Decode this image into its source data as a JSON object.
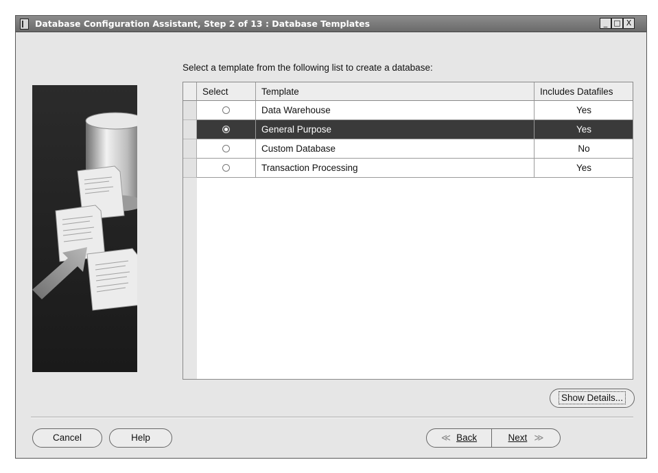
{
  "window": {
    "title": "Database Configuration Assistant, Step 2 of 13 : Database Templates",
    "controls": {
      "minimize": "_",
      "maximize": "□",
      "close": "X"
    }
  },
  "prompt": "Select a template from the following list to create a database:",
  "table": {
    "columns": [
      "Select",
      "Template",
      "Includes Datafiles"
    ],
    "rows": [
      {
        "selected": false,
        "template": "Data Warehouse",
        "includes_datafiles": "Yes"
      },
      {
        "selected": true,
        "template": "General Purpose",
        "includes_datafiles": "Yes"
      },
      {
        "selected": false,
        "template": "Custom Database",
        "includes_datafiles": "No"
      },
      {
        "selected": false,
        "template": "Transaction Processing",
        "includes_datafiles": "Yes"
      }
    ]
  },
  "buttons": {
    "show_details": "Show Details...",
    "cancel": "Cancel",
    "help": "Help",
    "back_arrow": "≪",
    "back": "Back",
    "next": "Next",
    "next_arrow": "≫"
  },
  "icons": {
    "side_illustration": "database-cylinder-with-documents-and-arrow",
    "app_icon": "database-assistant-icon"
  },
  "colors": {
    "selected_row": "#3a3a3a",
    "title_bar": "#7a7a7a",
    "window_bg": "#e6e6e6"
  }
}
